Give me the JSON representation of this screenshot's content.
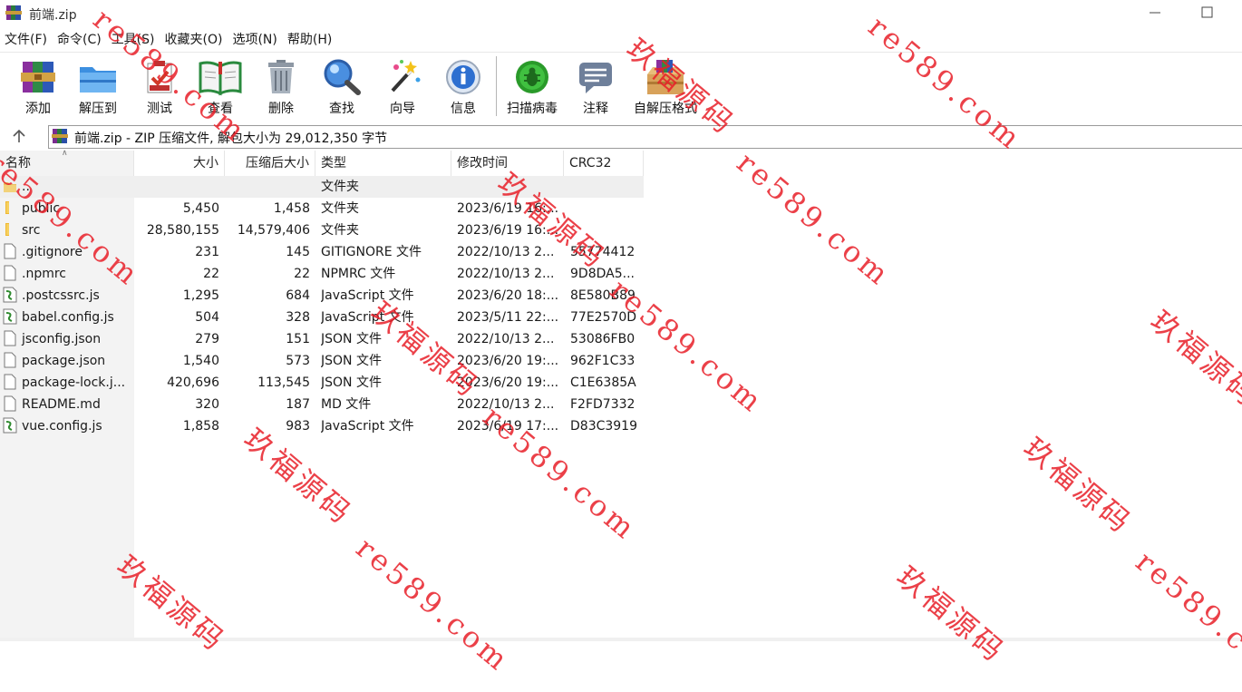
{
  "window": {
    "title": "前端.zip"
  },
  "menu": [
    {
      "key": "file",
      "label": "文件(F)"
    },
    {
      "key": "command",
      "label": "命令(C)"
    },
    {
      "key": "tools",
      "label": "工具(S)"
    },
    {
      "key": "favorites",
      "label": "收藏夹(O)"
    },
    {
      "key": "options",
      "label": "选项(N)"
    },
    {
      "key": "help",
      "label": "帮助(H)"
    }
  ],
  "toolbar": {
    "add": "添加",
    "extract": "解压到",
    "test": "测试",
    "view": "查看",
    "delete": "删除",
    "find": "查找",
    "wizard": "向导",
    "info": "信息",
    "virus_scan": "扫描病毒",
    "comment": "注释",
    "sfx": "自解压格式"
  },
  "address": {
    "text": "前端.zip - ZIP 压缩文件, 解包大小为 29,012,350 字节"
  },
  "columns": {
    "name": "名称",
    "size": "大小",
    "packed": "压缩后大小",
    "type": "类型",
    "modified": "修改时间",
    "crc": "CRC32"
  },
  "files": [
    {
      "name": "..",
      "size": "",
      "packed": "",
      "type": "文件夹",
      "modified": "",
      "crc": "",
      "icon": "folder-up"
    },
    {
      "name": "public",
      "size": "5,450",
      "packed": "1,458",
      "type": "文件夹",
      "modified": "2023/6/19 16:...",
      "crc": "",
      "icon": "folder"
    },
    {
      "name": "src",
      "size": "28,580,155",
      "packed": "14,579,406",
      "type": "文件夹",
      "modified": "2023/6/19 16:...",
      "crc": "",
      "icon": "folder"
    },
    {
      "name": ".gitignore",
      "size": "231",
      "packed": "145",
      "type": "GITIGNORE 文件",
      "modified": "2022/10/13 2...",
      "crc": "55774412",
      "icon": "file"
    },
    {
      "name": ".npmrc",
      "size": "22",
      "packed": "22",
      "type": "NPMRC 文件",
      "modified": "2022/10/13 2...",
      "crc": "9D8DA5...",
      "icon": "file"
    },
    {
      "name": ".postcssrc.js",
      "size": "1,295",
      "packed": "684",
      "type": "JavaScript 文件",
      "modified": "2023/6/20 18:...",
      "crc": "8E580B89",
      "icon": "js"
    },
    {
      "name": "babel.config.js",
      "size": "504",
      "packed": "328",
      "type": "JavaScript 文件",
      "modified": "2023/5/11 22:...",
      "crc": "77E2570D",
      "icon": "js"
    },
    {
      "name": "jsconfig.json",
      "size": "279",
      "packed": "151",
      "type": "JSON 文件",
      "modified": "2022/10/13 2...",
      "crc": "53086FB0",
      "icon": "file"
    },
    {
      "name": "package.json",
      "size": "1,540",
      "packed": "573",
      "type": "JSON 文件",
      "modified": "2023/6/20 19:...",
      "crc": "962F1C33",
      "icon": "file"
    },
    {
      "name": "package-lock.j...",
      "size": "420,696",
      "packed": "113,545",
      "type": "JSON 文件",
      "modified": "2023/6/20 19:...",
      "crc": "C1E6385A",
      "icon": "file"
    },
    {
      "name": "README.md",
      "size": "320",
      "packed": "187",
      "type": "MD 文件",
      "modified": "2022/10/13 2...",
      "crc": "F2FD7332",
      "icon": "file"
    },
    {
      "name": "vue.config.js",
      "size": "1,858",
      "packed": "983",
      "type": "JavaScript 文件",
      "modified": "2023/6/19 17:...",
      "crc": "D83C3919",
      "icon": "js"
    }
  ],
  "watermark": {
    "cn": "玖福源码",
    "url": "re589.com",
    "color": "#e81e28"
  }
}
